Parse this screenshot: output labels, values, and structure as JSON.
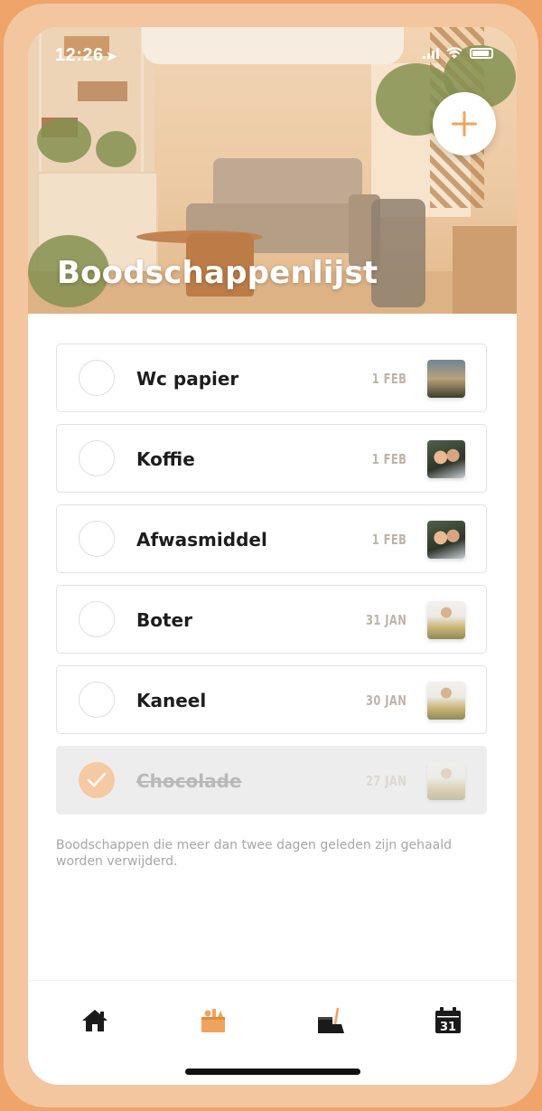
{
  "status_bar": {
    "time": "12:26"
  },
  "header": {
    "title": "Boodschappenlijst"
  },
  "items": [
    {
      "name": "Wc papier",
      "date": "1 FEB",
      "done": false,
      "avatar": "a1"
    },
    {
      "name": "Koffie",
      "date": "1 FEB",
      "done": false,
      "avatar": "a2"
    },
    {
      "name": "Afwasmiddel",
      "date": "1 FEB",
      "done": false,
      "avatar": "a2"
    },
    {
      "name": "Boter",
      "date": "31 JAN",
      "done": false,
      "avatar": "a3"
    },
    {
      "name": "Kaneel",
      "date": "30 JAN",
      "done": false,
      "avatar": "a3"
    },
    {
      "name": "Chocolade",
      "date": "27 JAN",
      "done": true,
      "avatar": "a3"
    }
  ],
  "footer_note": "Boodschappen die meer dan twee dagen geleden zijn gehaald worden verwijderd.",
  "tabs": [
    {
      "icon": "home-icon",
      "active": false
    },
    {
      "icon": "shopping-basket-icon",
      "active": true
    },
    {
      "icon": "cleaning-icon",
      "active": false
    },
    {
      "icon": "calendar-icon",
      "active": false,
      "day": "31"
    }
  ],
  "colors": {
    "accent": "#f0a35e",
    "accent_light": "#f5c9a1",
    "frame": "#f3c69f",
    "text": "#1d1d1d",
    "muted": "#a7a7a7"
  }
}
